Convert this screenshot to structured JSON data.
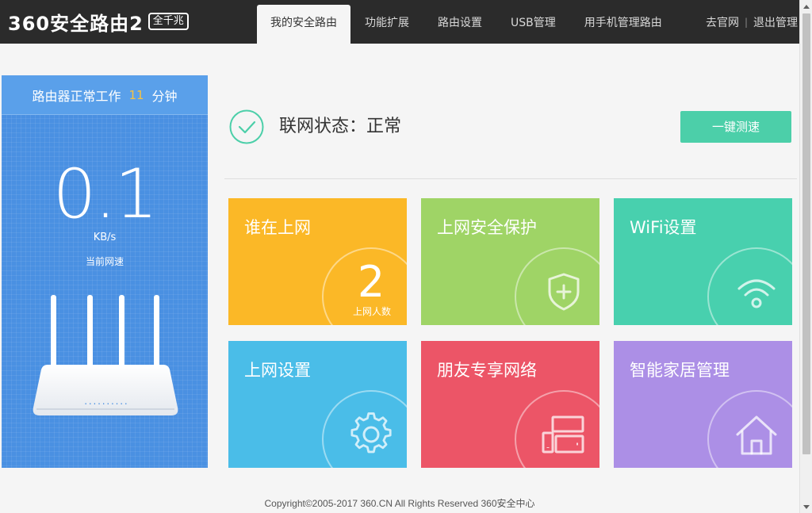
{
  "header": {
    "logo_text": "360安全路由2",
    "logo_badge": "全千兆",
    "nav": [
      {
        "label": "我的安全路由",
        "active": true
      },
      {
        "label": "功能扩展"
      },
      {
        "label": "路由设置"
      },
      {
        "label": "USB管理"
      },
      {
        "label": "用手机管理路由"
      }
    ],
    "links": {
      "website": "去官网",
      "separator": "|",
      "logout": "退出管理"
    }
  },
  "left_panel": {
    "uptime_prefix": "路由器正常工作",
    "uptime_value": "11",
    "uptime_suffix": "分钟",
    "speed_value": "0.1",
    "speed_unit": "KB/s",
    "speed_label": "当前网速",
    "led_dots": ". . . . . . . . . ."
  },
  "status": {
    "text": "联网状态：正常",
    "speed_test_label": "一键测速"
  },
  "tiles": [
    {
      "title": "谁在上网",
      "count": "2",
      "count_label": "上网人数",
      "color": "#fbb827",
      "icon": "count"
    },
    {
      "title": "上网安全保护",
      "color": "#9fd466",
      "icon": "shield-icon"
    },
    {
      "title": "WiFi设置",
      "color": "#48d0ae",
      "icon": "wifi-icon"
    },
    {
      "title": "上网设置",
      "color": "#4abde8",
      "icon": "gear-icon"
    },
    {
      "title": "朋友专享网络",
      "color": "#ec5567",
      "icon": "devices-icon"
    },
    {
      "title": "智能家居管理",
      "color": "#ac8fe6",
      "icon": "home-icon"
    }
  ],
  "footer": {
    "copyright": "Copyright©2005-2017 360.CN All Rights Reserved 360安全中心"
  },
  "colors": {
    "header_bg": "#2b2b2b",
    "panel_blue": "#4a90e2",
    "accent_green": "#4ccfa9",
    "uptime_number": "#f5c342"
  }
}
